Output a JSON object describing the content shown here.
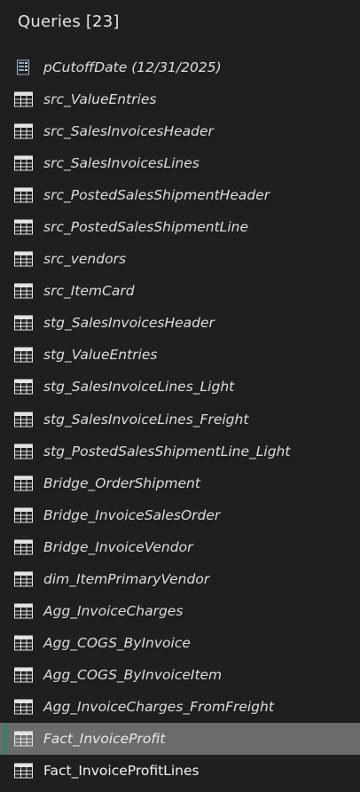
{
  "pane": {
    "title": "Queries [23]"
  },
  "colors": {
    "background": "#1f1f1f",
    "selected_background": "#6b6b6b",
    "selected_accent": "#1e8a6e",
    "text": "#dedede"
  },
  "queries": [
    {
      "label": "pCutoffDate (12/31/2025)",
      "icon": "parameter-icon",
      "italic": true
    },
    {
      "label": "src_ValueEntries",
      "icon": "table-icon",
      "italic": true
    },
    {
      "label": "src_SalesInvoicesHeader",
      "icon": "table-icon",
      "italic": true
    },
    {
      "label": "src_SalesInvoicesLines",
      "icon": "table-icon",
      "italic": true
    },
    {
      "label": "src_PostedSalesShipmentHeader",
      "icon": "table-icon",
      "italic": true
    },
    {
      "label": "src_PostedSalesShipmentLine",
      "icon": "table-icon",
      "italic": true
    },
    {
      "label": "src_vendors",
      "icon": "table-icon",
      "italic": true
    },
    {
      "label": "src_ItemCard",
      "icon": "table-icon",
      "italic": true
    },
    {
      "label": "stg_SalesInvoicesHeader",
      "icon": "table-icon",
      "italic": true
    },
    {
      "label": "stg_ValueEntries",
      "icon": "table-icon",
      "italic": true
    },
    {
      "label": "stg_SalesInvoiceLines_Light",
      "icon": "table-icon",
      "italic": true
    },
    {
      "label": "stg_SalesInvoiceLines_Freight",
      "icon": "table-icon",
      "italic": true
    },
    {
      "label": "stg_PostedSalesShipmentLine_Light",
      "icon": "table-icon",
      "italic": true
    },
    {
      "label": "Bridge_OrderShipment",
      "icon": "table-icon",
      "italic": true
    },
    {
      "label": "Bridge_InvoiceSalesOrder",
      "icon": "table-icon",
      "italic": true
    },
    {
      "label": "Bridge_InvoiceVendor",
      "icon": "table-icon",
      "italic": true
    },
    {
      "label": "dim_ItemPrimaryVendor",
      "icon": "table-icon",
      "italic": true
    },
    {
      "label": "Agg_InvoiceCharges",
      "icon": "table-icon",
      "italic": true
    },
    {
      "label": "Agg_COGS_ByInvoice",
      "icon": "table-icon",
      "italic": true
    },
    {
      "label": "Agg_COGS_ByInvoiceItem",
      "icon": "table-icon",
      "italic": true
    },
    {
      "label": "Agg_InvoiceCharges_FromFreight",
      "icon": "table-icon",
      "italic": true
    },
    {
      "label": "Fact_InvoiceProfit",
      "icon": "table-icon",
      "italic": true,
      "selected": true
    },
    {
      "label": "Fact_InvoiceProfitLines",
      "icon": "table-icon",
      "italic": false
    }
  ]
}
